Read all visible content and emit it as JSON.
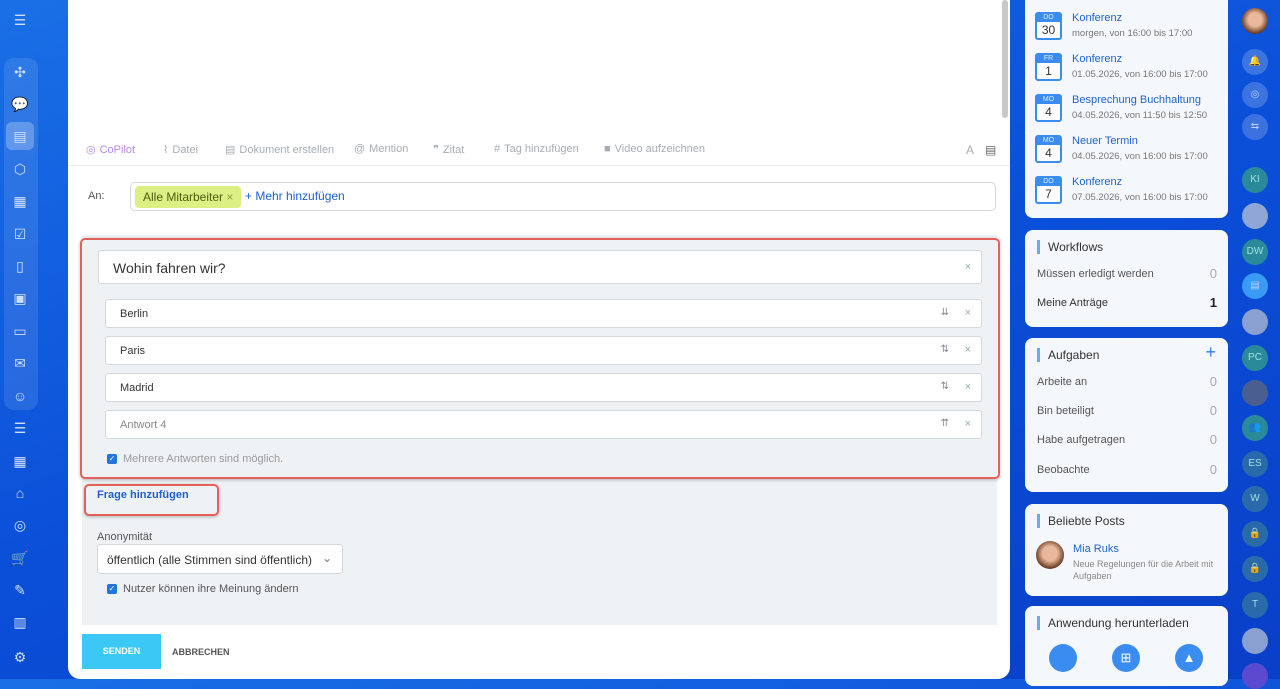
{
  "toolbar": {
    "copilot": "CoPilot",
    "file": "Datei",
    "doc": "Dokument erstellen",
    "mention": "Mention",
    "quote": "Zitat",
    "tag": "Tag hinzufügen",
    "video": "Video aufzeichnen"
  },
  "recipients": {
    "label": "An:",
    "tag": "Alle Mitarbeiter",
    "add_more": "+ Mehr hinzufügen"
  },
  "poll": {
    "question": "Wohin fahren wir?",
    "answers": [
      "Berlin",
      "Paris",
      "Madrid"
    ],
    "answer_placeholder": "Antwort  4",
    "multiple": "Mehrere Antworten sind möglich.",
    "add_question": "Frage hinzufügen",
    "anonymity_label": "Anonymität",
    "anonymity_value": "öffentlich (alle Stimmen sind öffentlich)",
    "change_opinion": "Nutzer können ihre Meinung ändern"
  },
  "buttons": {
    "send": "SENDEN",
    "cancel": "ABBRECHEN"
  },
  "events": [
    {
      "dow": "DO",
      "day": "30",
      "title": "Konferenz",
      "time": "morgen, von 16:00 bis 17:00"
    },
    {
      "dow": "FR",
      "day": "1",
      "title": "Konferenz",
      "time": "01.05.2026, von 16:00 bis 17:00"
    },
    {
      "dow": "MO",
      "day": "4",
      "title": "Besprechung Buchhaltung",
      "time": "04.05.2026, von 11:50 bis 12:50"
    },
    {
      "dow": "MO",
      "day": "4",
      "title": "Neuer Termin",
      "time": "04.05.2026, von 16:00 bis 17:00"
    },
    {
      "dow": "DO",
      "day": "7",
      "title": "Konferenz",
      "time": "07.05.2026, von 16:00 bis 17:00"
    }
  ],
  "workflows": {
    "title": "Workflows",
    "rows": [
      {
        "label": "Müssen erledigt werden",
        "count": "0"
      },
      {
        "label": "Meine Anträge",
        "count": "1"
      }
    ]
  },
  "tasks": {
    "title": "Aufgaben",
    "add": "+",
    "rows": [
      {
        "label": "Arbeite an",
        "count": "0"
      },
      {
        "label": "Bin beteiligt",
        "count": "0"
      },
      {
        "label": "Habe aufgetragen",
        "count": "0"
      },
      {
        "label": "Beobachte",
        "count": "0"
      }
    ]
  },
  "posts": {
    "title": "Beliebte Posts",
    "author": "Mia Ruks",
    "text": "Neue Regelungen für die Arbeit mit Aufgaben"
  },
  "apps": {
    "title": "Anwendung herunterladen"
  },
  "avatars": [
    "KI",
    "DW",
    "PC",
    "ES",
    "W",
    "T"
  ]
}
